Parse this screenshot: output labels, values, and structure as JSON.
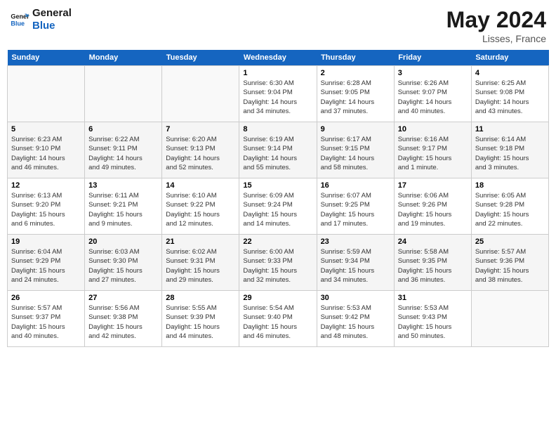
{
  "header": {
    "logo_general": "General",
    "logo_blue": "Blue",
    "month_year": "May 2024",
    "location": "Lisses, France"
  },
  "days_of_week": [
    "Sunday",
    "Monday",
    "Tuesday",
    "Wednesday",
    "Thursday",
    "Friday",
    "Saturday"
  ],
  "weeks": [
    [
      {
        "num": "",
        "info": ""
      },
      {
        "num": "",
        "info": ""
      },
      {
        "num": "",
        "info": ""
      },
      {
        "num": "1",
        "info": "Sunrise: 6:30 AM\nSunset: 9:04 PM\nDaylight: 14 hours\nand 34 minutes."
      },
      {
        "num": "2",
        "info": "Sunrise: 6:28 AM\nSunset: 9:05 PM\nDaylight: 14 hours\nand 37 minutes."
      },
      {
        "num": "3",
        "info": "Sunrise: 6:26 AM\nSunset: 9:07 PM\nDaylight: 14 hours\nand 40 minutes."
      },
      {
        "num": "4",
        "info": "Sunrise: 6:25 AM\nSunset: 9:08 PM\nDaylight: 14 hours\nand 43 minutes."
      }
    ],
    [
      {
        "num": "5",
        "info": "Sunrise: 6:23 AM\nSunset: 9:10 PM\nDaylight: 14 hours\nand 46 minutes."
      },
      {
        "num": "6",
        "info": "Sunrise: 6:22 AM\nSunset: 9:11 PM\nDaylight: 14 hours\nand 49 minutes."
      },
      {
        "num": "7",
        "info": "Sunrise: 6:20 AM\nSunset: 9:13 PM\nDaylight: 14 hours\nand 52 minutes."
      },
      {
        "num": "8",
        "info": "Sunrise: 6:19 AM\nSunset: 9:14 PM\nDaylight: 14 hours\nand 55 minutes."
      },
      {
        "num": "9",
        "info": "Sunrise: 6:17 AM\nSunset: 9:15 PM\nDaylight: 14 hours\nand 58 minutes."
      },
      {
        "num": "10",
        "info": "Sunrise: 6:16 AM\nSunset: 9:17 PM\nDaylight: 15 hours\nand 1 minute."
      },
      {
        "num": "11",
        "info": "Sunrise: 6:14 AM\nSunset: 9:18 PM\nDaylight: 15 hours\nand 3 minutes."
      }
    ],
    [
      {
        "num": "12",
        "info": "Sunrise: 6:13 AM\nSunset: 9:20 PM\nDaylight: 15 hours\nand 6 minutes."
      },
      {
        "num": "13",
        "info": "Sunrise: 6:11 AM\nSunset: 9:21 PM\nDaylight: 15 hours\nand 9 minutes."
      },
      {
        "num": "14",
        "info": "Sunrise: 6:10 AM\nSunset: 9:22 PM\nDaylight: 15 hours\nand 12 minutes."
      },
      {
        "num": "15",
        "info": "Sunrise: 6:09 AM\nSunset: 9:24 PM\nDaylight: 15 hours\nand 14 minutes."
      },
      {
        "num": "16",
        "info": "Sunrise: 6:07 AM\nSunset: 9:25 PM\nDaylight: 15 hours\nand 17 minutes."
      },
      {
        "num": "17",
        "info": "Sunrise: 6:06 AM\nSunset: 9:26 PM\nDaylight: 15 hours\nand 19 minutes."
      },
      {
        "num": "18",
        "info": "Sunrise: 6:05 AM\nSunset: 9:28 PM\nDaylight: 15 hours\nand 22 minutes."
      }
    ],
    [
      {
        "num": "19",
        "info": "Sunrise: 6:04 AM\nSunset: 9:29 PM\nDaylight: 15 hours\nand 24 minutes."
      },
      {
        "num": "20",
        "info": "Sunrise: 6:03 AM\nSunset: 9:30 PM\nDaylight: 15 hours\nand 27 minutes."
      },
      {
        "num": "21",
        "info": "Sunrise: 6:02 AM\nSunset: 9:31 PM\nDaylight: 15 hours\nand 29 minutes."
      },
      {
        "num": "22",
        "info": "Sunrise: 6:00 AM\nSunset: 9:33 PM\nDaylight: 15 hours\nand 32 minutes."
      },
      {
        "num": "23",
        "info": "Sunrise: 5:59 AM\nSunset: 9:34 PM\nDaylight: 15 hours\nand 34 minutes."
      },
      {
        "num": "24",
        "info": "Sunrise: 5:58 AM\nSunset: 9:35 PM\nDaylight: 15 hours\nand 36 minutes."
      },
      {
        "num": "25",
        "info": "Sunrise: 5:57 AM\nSunset: 9:36 PM\nDaylight: 15 hours\nand 38 minutes."
      }
    ],
    [
      {
        "num": "26",
        "info": "Sunrise: 5:57 AM\nSunset: 9:37 PM\nDaylight: 15 hours\nand 40 minutes."
      },
      {
        "num": "27",
        "info": "Sunrise: 5:56 AM\nSunset: 9:38 PM\nDaylight: 15 hours\nand 42 minutes."
      },
      {
        "num": "28",
        "info": "Sunrise: 5:55 AM\nSunset: 9:39 PM\nDaylight: 15 hours\nand 44 minutes."
      },
      {
        "num": "29",
        "info": "Sunrise: 5:54 AM\nSunset: 9:40 PM\nDaylight: 15 hours\nand 46 minutes."
      },
      {
        "num": "30",
        "info": "Sunrise: 5:53 AM\nSunset: 9:42 PM\nDaylight: 15 hours\nand 48 minutes."
      },
      {
        "num": "31",
        "info": "Sunrise: 5:53 AM\nSunset: 9:43 PM\nDaylight: 15 hours\nand 50 minutes."
      },
      {
        "num": "",
        "info": ""
      }
    ]
  ]
}
